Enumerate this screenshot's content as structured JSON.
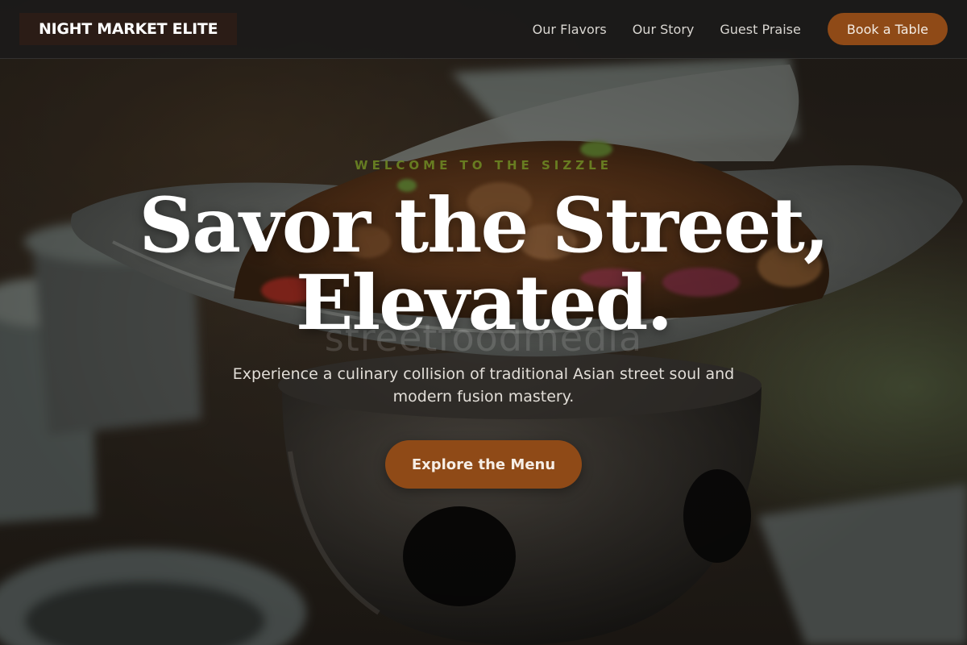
{
  "nav": {
    "brand": "NIGHT MARKET ELITE",
    "links": [
      "Our Flavors",
      "Our Story",
      "Guest Praise"
    ],
    "cta": "Book a Table"
  },
  "hero": {
    "eyebrow": "WELCOME TO THE SIZZLE",
    "headline_line1": "Savor the Street,",
    "headline_line2": "Elevated.",
    "watermark": "streetfoodmedia",
    "subheadline": "Experience a culinary collision of traditional Asian street soul and modern fusion mastery.",
    "cta": "Explore the Menu"
  },
  "colors": {
    "accent": "#8f4a17",
    "eyebrow": "#6f8b24",
    "nav_bg": "#1c1b1a",
    "brand_bg": "#2b1c16"
  }
}
